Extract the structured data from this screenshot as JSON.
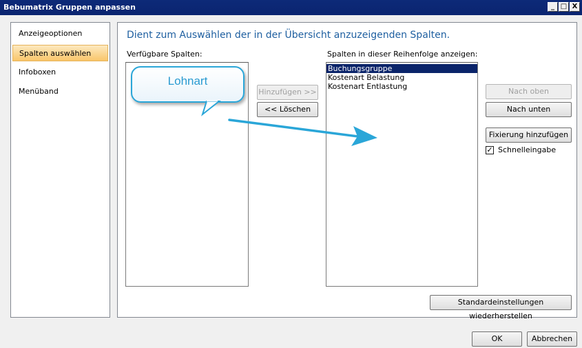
{
  "window": {
    "title": "Bebumatrix Gruppen anpassen",
    "controls": [
      "_",
      "□",
      "X"
    ]
  },
  "nav": {
    "items": [
      {
        "label": "Anzeigeoptionen",
        "selected": false
      },
      {
        "label": "Spalten auswählen",
        "selected": true
      },
      {
        "label": "Infoboxen",
        "selected": false
      },
      {
        "label": "Menüband",
        "selected": false
      }
    ]
  },
  "content": {
    "title": "Dient zum Auswählen der in der Übersicht anzuzeigenden Spalten.",
    "available_label": "Verfügbare Spalten:",
    "shown_label": "Spalten in dieser Reihenfolge anzeigen:",
    "shown_columns": [
      "Buchungsgruppe",
      "Kostenart Belastung",
      "Kostenart Entlastung"
    ],
    "add_button": "Hinzufügen >>",
    "remove_button": "<< Löschen",
    "move_up_button": "Nach oben",
    "move_down_button": "Nach unten",
    "fix_button": "Fixierung hinzufügen",
    "quick_entry_label": "Schnelleingabe",
    "quick_entry_checked": true,
    "reset_button": "Standardeinstellungen wiederherstellen"
  },
  "footer": {
    "ok_button": "OK",
    "cancel_button": "Abbrechen"
  },
  "annotation": {
    "callout_text": "Lohnart",
    "accent_color": "#2aa6d8"
  }
}
